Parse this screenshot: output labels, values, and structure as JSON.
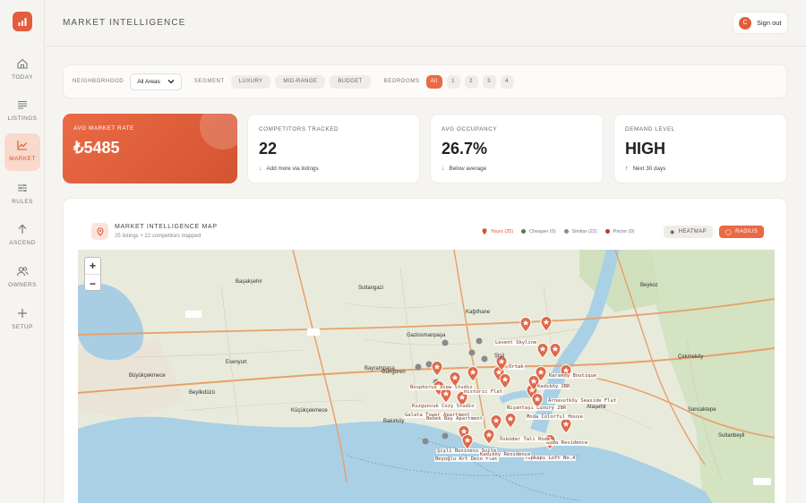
{
  "app": {
    "page_title": "MARKET INTELLIGENCE",
    "signout_label": "Sign out",
    "avatar_initial": "C"
  },
  "nav": [
    {
      "label": "TODAY",
      "icon": "home-icon"
    },
    {
      "label": "LISTINGS",
      "icon": "listings-icon"
    },
    {
      "label": "MARKET",
      "icon": "chart-icon",
      "active": true
    },
    {
      "label": "RULES",
      "icon": "rules-icon"
    },
    {
      "label": "ASCEND",
      "icon": "arrow-up-icon"
    },
    {
      "label": "OWNERS",
      "icon": "owners-icon"
    },
    {
      "label": "SETUP",
      "icon": "plus-icon"
    }
  ],
  "filters": {
    "neighborhood_label": "NEIGHBORHOOD",
    "neighborhood_value": "All Areas",
    "segment_label": "SEGMENT",
    "segments": [
      "LUXURY",
      "MID-RANGE",
      "BUDGET"
    ],
    "bedrooms_label": "BEDROOMS",
    "bedrooms": [
      "All",
      "1",
      "2",
      "3",
      "4"
    ]
  },
  "stats": [
    {
      "title": "AVG MARKET RATE",
      "value": "₺5485",
      "sub": ""
    },
    {
      "title": "COMPETITORS TRACKED",
      "value": "22",
      "sub": "Add more via listings",
      "arrow": "↓"
    },
    {
      "title": "AVG OCCUPANCY",
      "value": "26.7%",
      "sub": "Below average",
      "arrow": "↓"
    },
    {
      "title": "DEMAND LEVEL",
      "value": "HIGH",
      "sub": "Next 30 days",
      "arrow": "↑"
    }
  ],
  "map_panel": {
    "title": "MARKET INTELLIGENCE MAP",
    "subtitle": "25 listings + 22 competitors mapped",
    "legend": [
      {
        "label": "Yours (25)",
        "color": "#d9532f"
      },
      {
        "label": "Cheaper (0)",
        "color": "#5b7a4a"
      },
      {
        "label": "Similar (22)",
        "color": "#8a8a8a"
      },
      {
        "label": "Pricier (0)",
        "color": "#c0392b"
      }
    ],
    "heatmap_label": "HEATMAP",
    "radius_label": "RADIUS",
    "zoom_in": "+",
    "zoom_out": "−"
  },
  "map": {
    "places": [
      "Başakşehir",
      "Sultangazi",
      "Beykoz",
      "Gaziosmanpaşa",
      "Kağıthane",
      "Esenyurt",
      "Güngören",
      "Çekmeköy",
      "Büyükçekmece",
      "Beylikdüzü",
      "Ataşehir",
      "Sancaktepe",
      "Küçükçekmece",
      "Bakırköy",
      "Sultanbeyli",
      "Şişli",
      "Bayrampaşa"
    ],
    "listing_labels": [
      "Levent Skyline",
      "Ortak",
      "Historic Flat",
      "Karaköy Boutique",
      "Bosphorus View Studio",
      "Moda Colorful House",
      "Nişantaşı Luxury 2BR",
      "Galata Tower Apartment",
      "Kuzguncuk Cozy Studio",
      "Bebek Bay Apartment",
      "Moda Residence",
      "Beyoğlu Art Deco Flat",
      "Topkapı Loft No.4",
      "Şişli Business Suite",
      "Üsküdar Tali Room",
      "Kadıköy Residence",
      "Kadıköy 2BR",
      "Arnavutköy Seaside Flat"
    ]
  }
}
